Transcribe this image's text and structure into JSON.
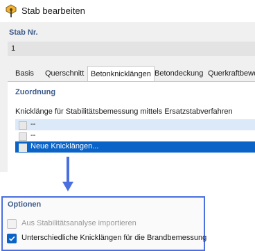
{
  "window": {
    "title": "Stab bearbeiten"
  },
  "member": {
    "header": "Stab Nr.",
    "number": "1"
  },
  "tabs": [
    {
      "label": "Basis",
      "active": false
    },
    {
      "label": "Querschnitt",
      "active": false
    },
    {
      "label": "Betonknicklängen",
      "active": true
    },
    {
      "label": "Betondeckung",
      "active": false
    },
    {
      "label": "Querkraftbewe",
      "active": false
    }
  ],
  "assignment": {
    "header": "Zuordnung",
    "label": "Knicklänge für Stabilitätsbemessung mittels Ersatzstabverfahren",
    "rows": [
      {
        "text": "--",
        "selected": false
      },
      {
        "text": "--",
        "selected": false
      },
      {
        "text": "Neue Knicklängen...",
        "selected": true
      }
    ]
  },
  "options": {
    "header": "Optionen",
    "items": [
      {
        "label": "Aus Stabilitätsanalyse importieren",
        "checked": false,
        "enabled": false
      },
      {
        "label": "Unterschiedliche Knicklängen für die Brandbemessung",
        "checked": true,
        "enabled": true
      }
    ]
  },
  "colors": {
    "accent": "#0a64c8",
    "highlight_border": "#4a6fe0",
    "section_header": "#3d5a8a"
  }
}
